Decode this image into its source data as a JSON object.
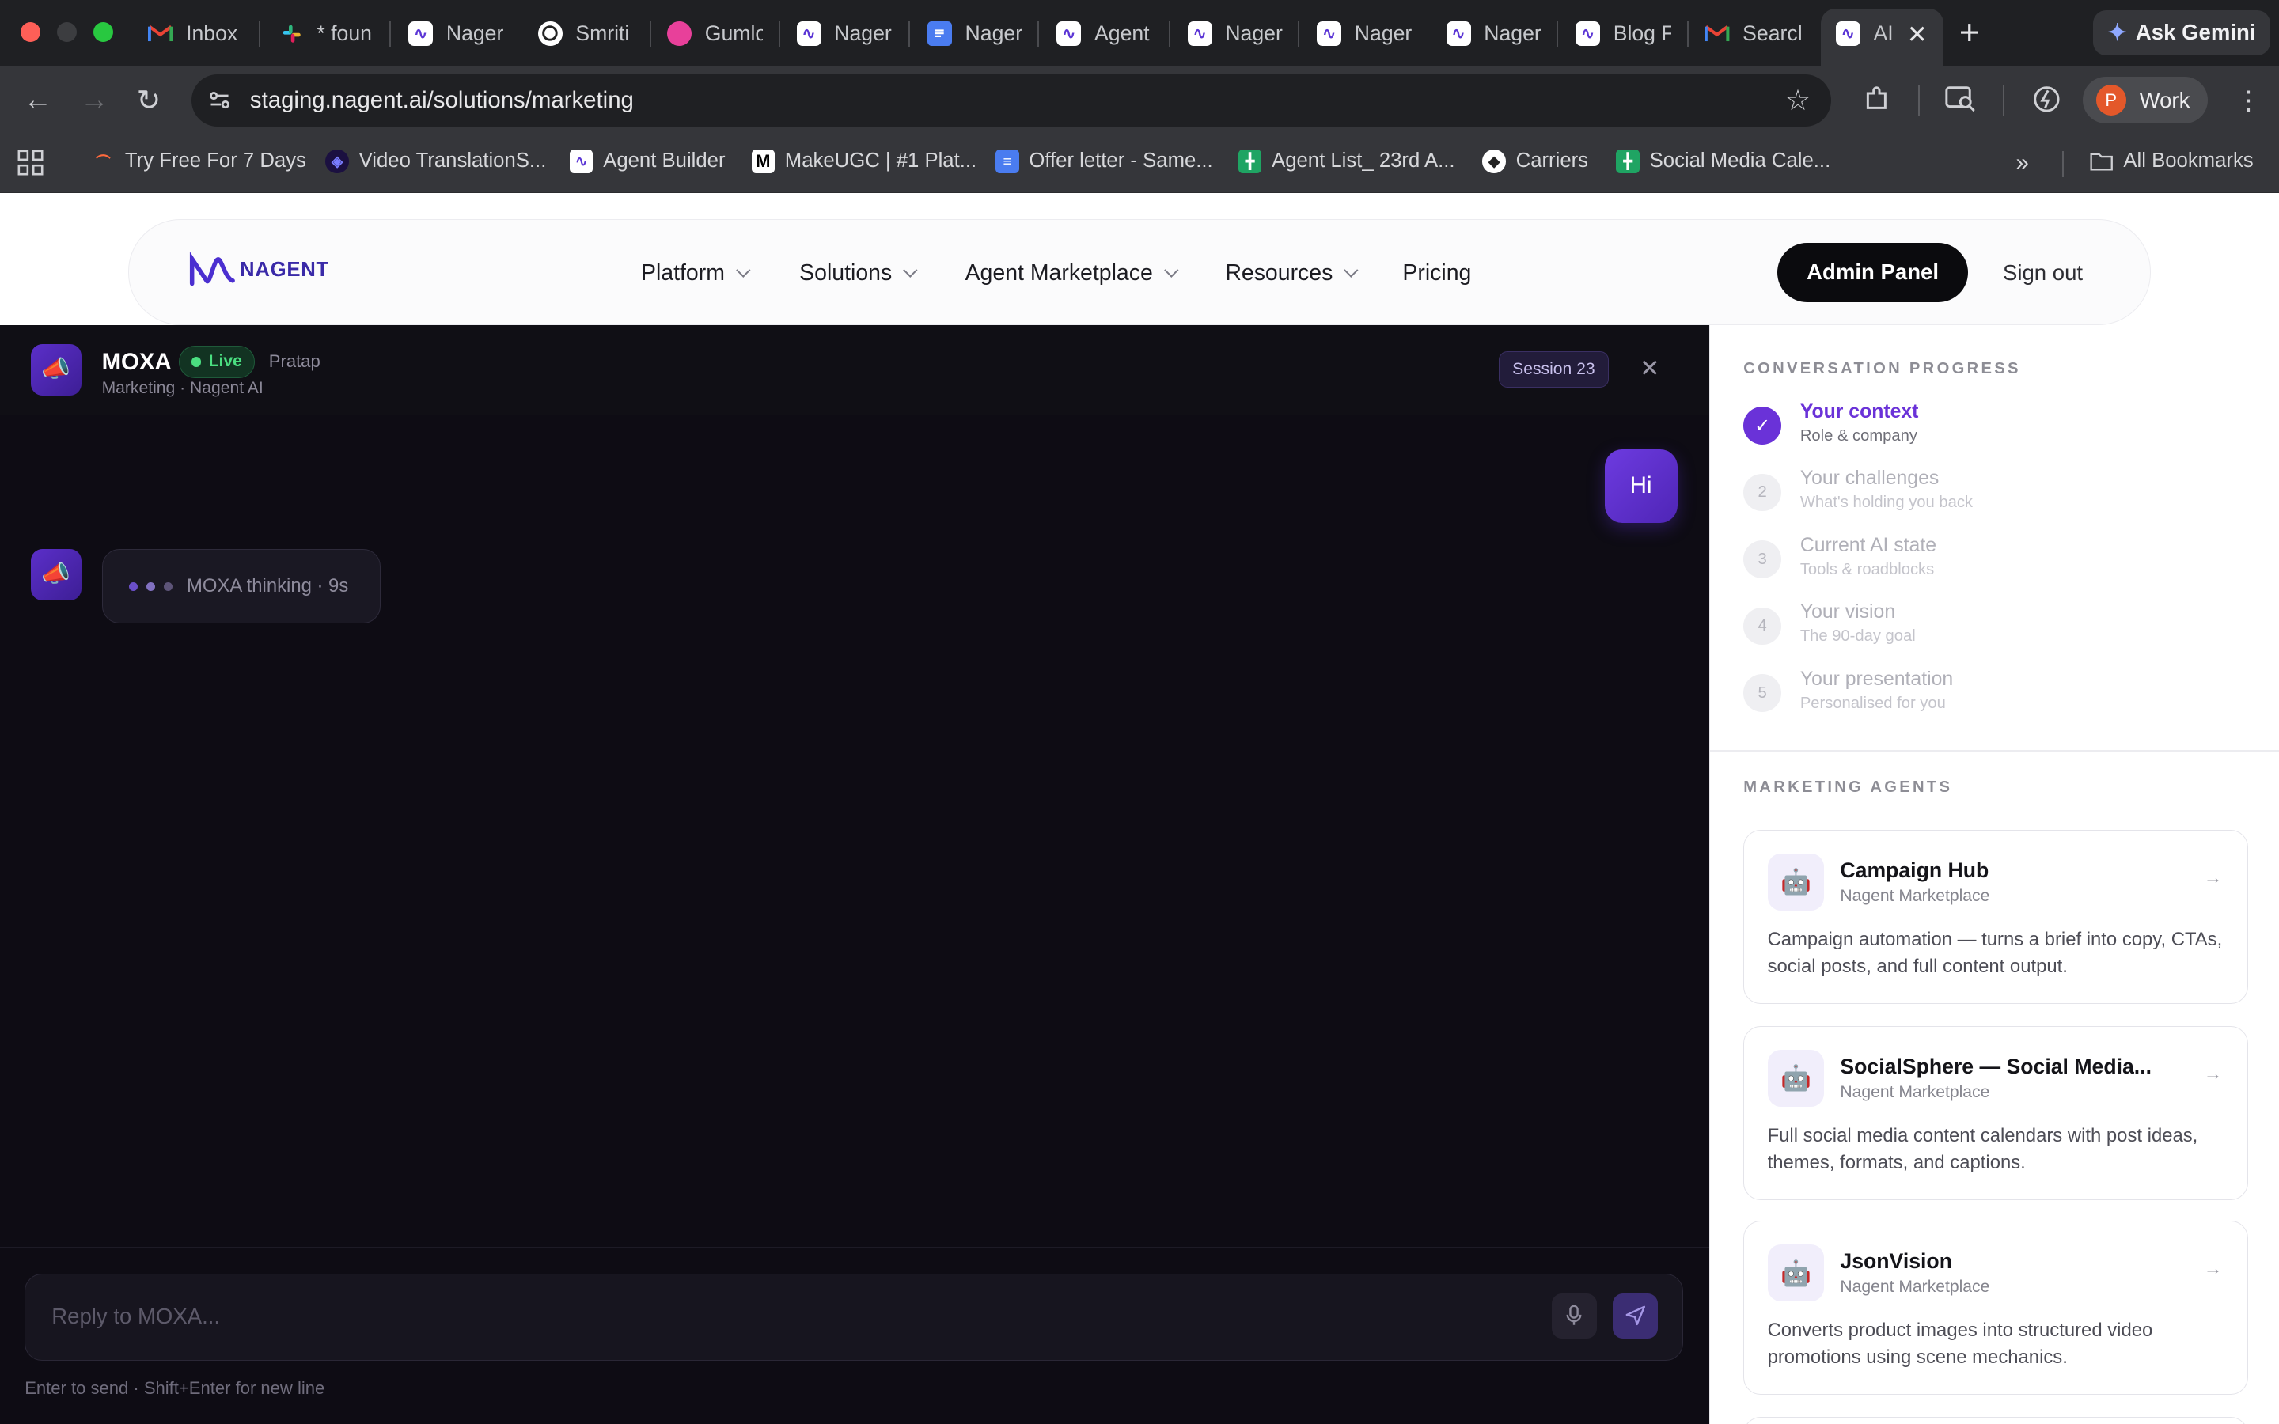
{
  "browser": {
    "tabs": [
      {
        "label": "Inbox",
        "icon": "gmail-icon"
      },
      {
        "label": "* foun",
        "icon": "slack-icon"
      },
      {
        "label": "Nager",
        "icon": "nagent-icon"
      },
      {
        "label": "Smriti",
        "icon": "chatgpt-icon"
      },
      {
        "label": "Gumlo",
        "icon": "gumloop-icon"
      },
      {
        "label": "Nager",
        "icon": "nagent-icon"
      },
      {
        "label": "Nager",
        "icon": "docs-icon"
      },
      {
        "label": "Agent",
        "icon": "nagent-icon"
      },
      {
        "label": "Nager",
        "icon": "nagent-icon"
      },
      {
        "label": "Nager",
        "icon": "nagent-icon"
      },
      {
        "label": "Nager",
        "icon": "nagent-icon"
      },
      {
        "label": "Blog F",
        "icon": "nagent-icon"
      },
      {
        "label": "Searcl",
        "icon": "gmail-icon"
      },
      {
        "label": "AI",
        "icon": "nagent-icon"
      }
    ],
    "gemini_label": "Ask Gemini",
    "url": "staging.nagent.ai/solutions/marketing",
    "profile_initial": "P",
    "profile_label": "Work",
    "bookmarks": [
      {
        "label": "Try Free For 7 Days"
      },
      {
        "label": "Video TranslationS..."
      },
      {
        "label": "Agent Builder"
      },
      {
        "label": "MakeUGC | #1 Plat..."
      },
      {
        "label": "Offer letter - Same..."
      },
      {
        "label": "Agent List_ 23rd A..."
      },
      {
        "label": "Carriers"
      },
      {
        "label": "Social Media Cale..."
      }
    ],
    "all_bookmarks": "All Bookmarks"
  },
  "site": {
    "logo_text": "NAGENT",
    "menu": [
      {
        "label": "Platform",
        "dropdown": true
      },
      {
        "label": "Solutions",
        "dropdown": true
      },
      {
        "label": "Agent Marketplace",
        "dropdown": true
      },
      {
        "label": "Resources",
        "dropdown": true
      },
      {
        "label": "Pricing",
        "dropdown": false
      }
    ],
    "admin_button": "Admin Panel",
    "sign_out": "Sign out"
  },
  "chat": {
    "agent_name": "MOXA",
    "status": "Live",
    "owner": "Pratap",
    "subtitle": "Marketing · Nagent AI",
    "session": "Session 23",
    "messages": [
      {
        "from": "user",
        "text": "Hi"
      },
      {
        "from": "agent",
        "text": "MOXA thinking · 9s"
      }
    ],
    "placeholder": "Reply to MOXA...",
    "hint": "Enter to send · Shift+Enter for new line"
  },
  "sidebar": {
    "progress_heading": "CONVERSATION PROGRESS",
    "steps": [
      {
        "num": "✓",
        "title": "Your context",
        "sub": "Role & company",
        "done": true
      },
      {
        "num": "2",
        "title": "Your challenges",
        "sub": "What's holding you back",
        "done": false
      },
      {
        "num": "3",
        "title": "Current AI state",
        "sub": "Tools & roadblocks",
        "done": false
      },
      {
        "num": "4",
        "title": "Your vision",
        "sub": "The 90-day goal",
        "done": false
      },
      {
        "num": "5",
        "title": "Your presentation",
        "sub": "Personalised for you",
        "done": false
      }
    ],
    "agents_heading": "MARKETING AGENTS",
    "agents": [
      {
        "name": "Campaign Hub",
        "source": "Nagent Marketplace",
        "desc": "Campaign automation — turns a brief into copy, CTAs, social posts, and full content output."
      },
      {
        "name": "SocialSphere — Social Media...",
        "source": "Nagent Marketplace",
        "desc": "Full social media content calendars with post ideas, themes, formats, and captions."
      },
      {
        "name": "JsonVision",
        "source": "Nagent Marketplace",
        "desc": "Converts product images into structured video promotions using scene mechanics."
      }
    ]
  },
  "colors": {
    "accent": "#6a32d8",
    "live_green": "#4ade80",
    "chat_bg": "#0e0c14"
  }
}
